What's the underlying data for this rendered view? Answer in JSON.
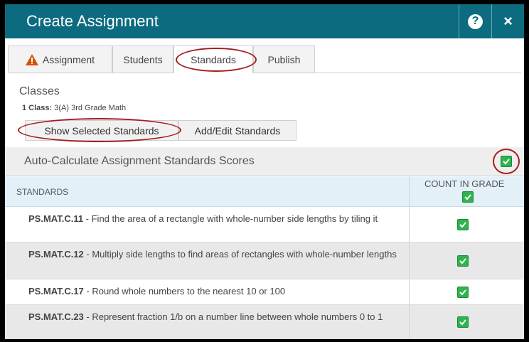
{
  "window": {
    "title": "Create Assignment",
    "help_label": "?",
    "close_label": "×"
  },
  "tabs": [
    {
      "label": "Assignment",
      "icon": "warning-icon",
      "icon_color": "#d35400"
    },
    {
      "label": "Students"
    },
    {
      "label": "Standards",
      "active": true
    },
    {
      "label": "Publish"
    }
  ],
  "classes": {
    "heading": "Classes",
    "count_label": "1 Class:",
    "class_name": "3(A) 3rd Grade Math"
  },
  "buttons": {
    "show_selected": "Show Selected Standards",
    "add_edit": "Add/Edit Standards"
  },
  "auto_calc": {
    "label": "Auto-Calculate Assignment Standards Scores",
    "checked": true
  },
  "table": {
    "col_standards": "STANDARDS",
    "col_count": "COUNT IN GRADE",
    "rows": [
      {
        "code": "PS.MAT.C.11",
        "description": " - Find the area of a rectangle with whole-number side lengths by tiling it",
        "count_in_grade": true
      },
      {
        "code": "PS.MAT.C.12",
        "description": " - Multiply side lengths to find areas of rectangles with whole-number lengths",
        "count_in_grade": true
      },
      {
        "code": "PS.MAT.C.17",
        "description": " - Round whole numbers to the nearest 10 or 100",
        "count_in_grade": true
      },
      {
        "code": "PS.MAT.C.23",
        "description": " - Represent fraction 1/b on a number line between whole numbers 0 to 1",
        "count_in_grade": true
      }
    ]
  },
  "colors": {
    "titlebar": "#0d6b80",
    "checkbox": "#2fb34f",
    "annotation_ring": "#a51d1d"
  }
}
